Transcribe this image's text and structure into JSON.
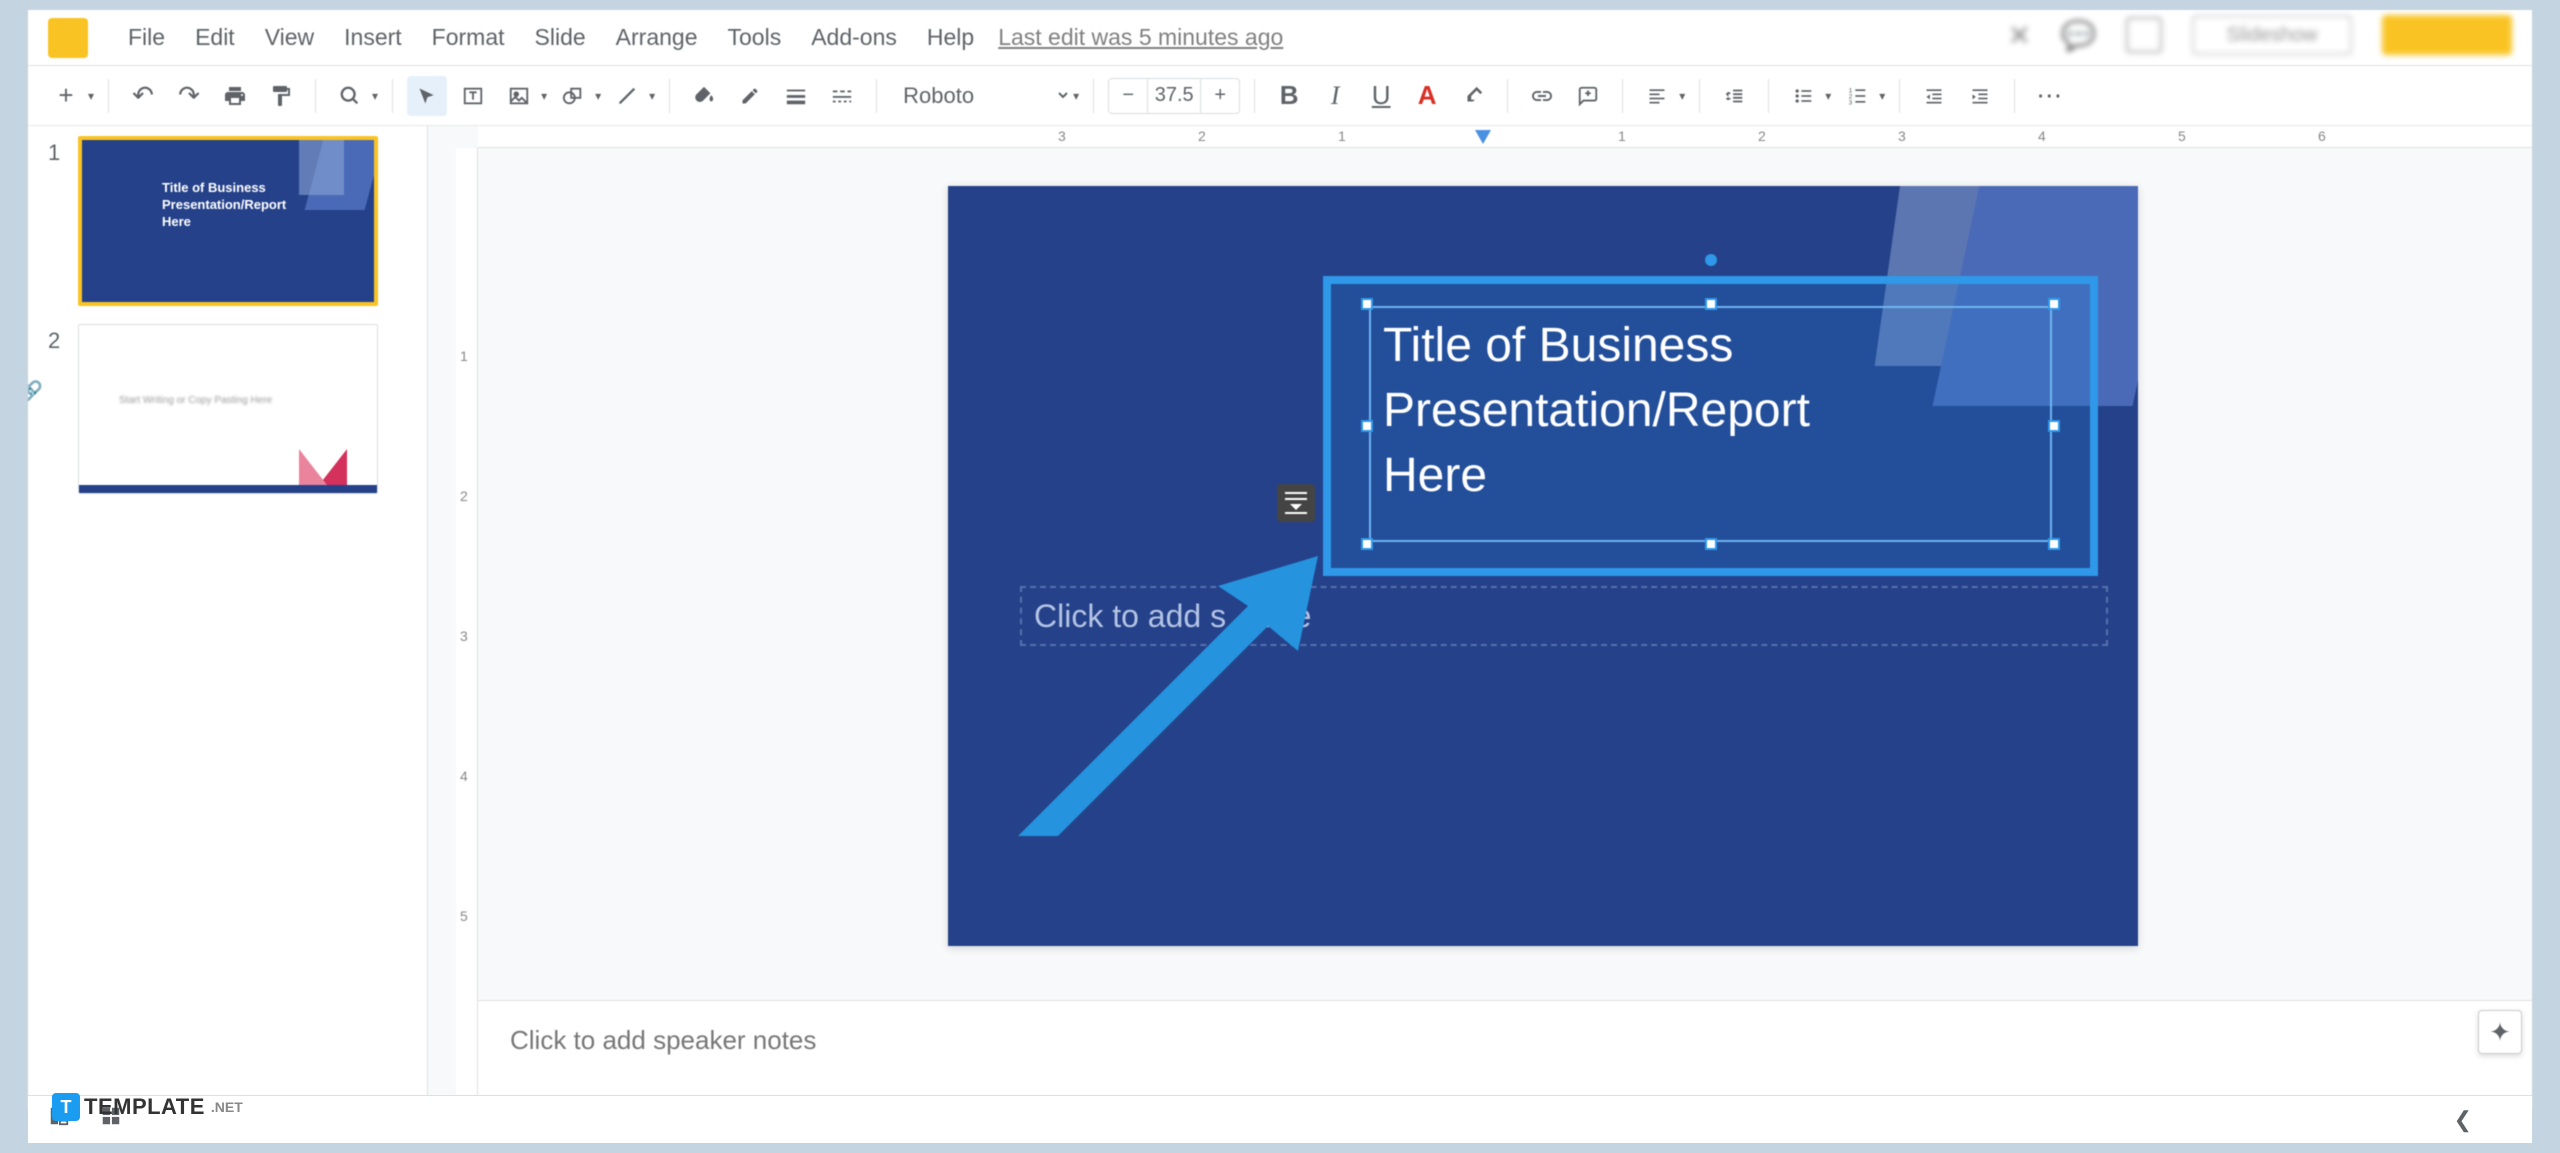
{
  "menus": {
    "file": "File",
    "edit": "Edit",
    "view": "View",
    "insert": "Insert",
    "format": "Format",
    "slide": "Slide",
    "arrange": "Arrange",
    "tools": "Tools",
    "addons": "Add-ons",
    "help": "Help"
  },
  "last_edit": "Last edit was 5 minutes ago",
  "toolbar": {
    "font_name": "Roboto",
    "font_size": "37.5",
    "plus": "+",
    "minus": "−"
  },
  "ruler_h": {
    "n3": "3",
    "n2": "2",
    "n1": "1",
    "p1": "1",
    "p2": "2",
    "p3": "3",
    "p4": "4",
    "p5": "5",
    "p6": "6"
  },
  "ruler_v": {
    "p1": "1",
    "p2": "2",
    "p3": "3",
    "p4": "4",
    "p5": "5"
  },
  "thumbs": {
    "num1": "1",
    "num2": "2",
    "t1_line1": "Title of Business",
    "t1_line2": "Presentation/Report",
    "t1_line3": "Here",
    "t2_text": "Start Writing or Copy Pasting Here"
  },
  "slide": {
    "title_line1": "Title of Business",
    "title_line2": "Presentation/Report",
    "title_line3": "Here",
    "subtitle_left": "Click to add s",
    "subtitle_right": "title"
  },
  "notes_placeholder": "Click to add speaker notes",
  "watermark": {
    "logo_letter": "T",
    "brand": "TEMPLATE",
    "net": ".NET"
  },
  "top_right": {
    "slideshow": "Slideshow"
  }
}
